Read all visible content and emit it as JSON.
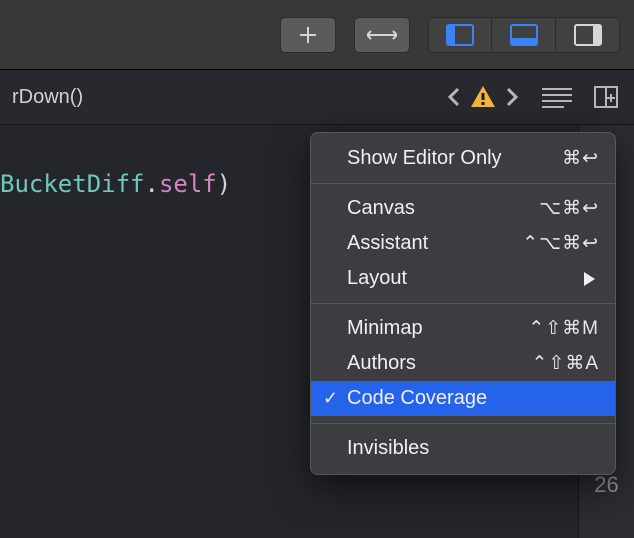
{
  "nav": {
    "crumb": "rDown()"
  },
  "code": {
    "type": "BucketDiff",
    "punc1": ".",
    "kw": "self",
    "punc2": ")"
  },
  "gutter": {
    "line": "26"
  },
  "menu": {
    "items": [
      {
        "label": "Show Editor Only",
        "short": "⌘↩︎"
      }
    ],
    "group2": [
      {
        "label": "Canvas",
        "short": "⌥⌘↩︎"
      },
      {
        "label": "Assistant",
        "short": "⌃⌥⌘↩︎"
      },
      {
        "label": "Layout",
        "short": ""
      }
    ],
    "group3": [
      {
        "label": "Minimap",
        "short": "⌃⇧⌘M"
      },
      {
        "label": "Authors",
        "short": "⌃⇧⌘A"
      },
      {
        "label": "Code Coverage",
        "short": ""
      }
    ],
    "group4": [
      {
        "label": "Invisibles",
        "short": ""
      }
    ]
  }
}
